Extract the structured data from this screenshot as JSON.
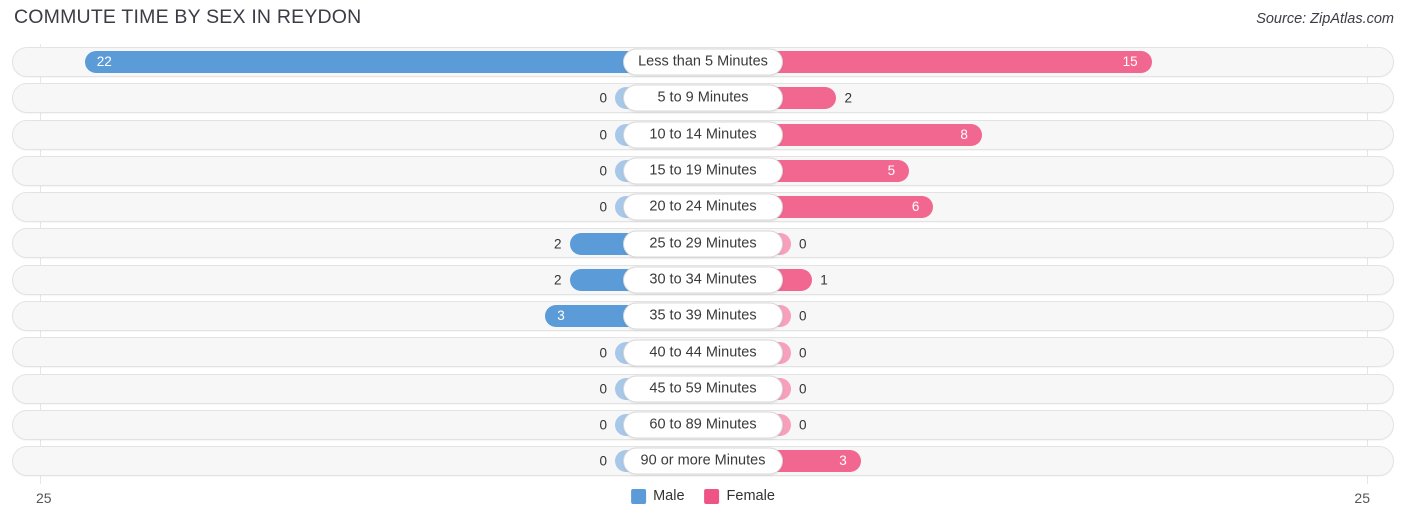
{
  "header": {
    "title": "COMMUTE TIME BY SEX IN REYDON",
    "source": "Source: ZipAtlas.com"
  },
  "footer": {
    "axis_left": "25",
    "axis_right": "25",
    "legend": [
      {
        "label": "Male",
        "color": "#5b9bd8"
      },
      {
        "label": "Female",
        "color": "#ee5586"
      }
    ]
  },
  "colors": {
    "male": "#5b9bd8",
    "female": "#f2678f",
    "male_zero": "#a8c8ea",
    "female_zero": "#f6a0bc",
    "track": "#f7f7f7",
    "track_border": "#e3e3e3"
  },
  "chart_data": {
    "type": "bar",
    "subtype": "diverging-bar",
    "title": "COMMUTE TIME BY SEX IN REYDON",
    "xlabel": "",
    "ylabel": "",
    "xlim": [
      25,
      25
    ],
    "axis_max": 25,
    "grid": true,
    "legend_position": "bottom-center",
    "categories": [
      "Less than 5 Minutes",
      "5 to 9 Minutes",
      "10 to 14 Minutes",
      "15 to 19 Minutes",
      "20 to 24 Minutes",
      "25 to 29 Minutes",
      "30 to 34 Minutes",
      "35 to 39 Minutes",
      "40 to 44 Minutes",
      "45 to 59 Minutes",
      "60 to 89 Minutes",
      "90 or more Minutes"
    ],
    "series": [
      {
        "name": "Male",
        "values": [
          22,
          0,
          0,
          0,
          0,
          2,
          2,
          3,
          0,
          0,
          0,
          0
        ]
      },
      {
        "name": "Female",
        "values": [
          15,
          2,
          8,
          5,
          6,
          0,
          1,
          0,
          0,
          0,
          0,
          3
        ]
      }
    ]
  }
}
